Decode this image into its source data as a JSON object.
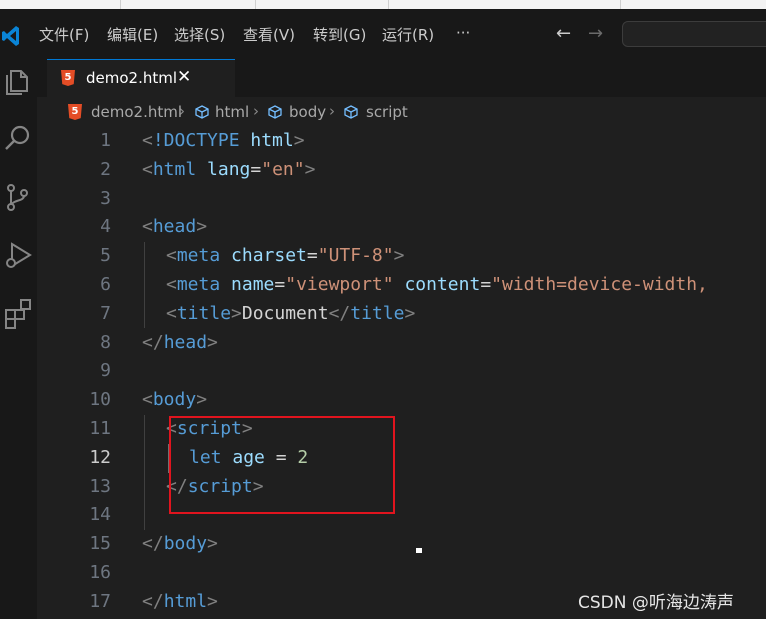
{
  "menu": [
    "文件(F)",
    "编辑(E)",
    "选择(S)",
    "查看(V)",
    "转到(G)",
    "运行(R)",
    "···"
  ],
  "tab": {
    "label": "demo2.html",
    "close": "✕"
  },
  "breadcrumb": [
    "demo2.html",
    "html",
    "body",
    "script"
  ],
  "editor": {
    "line_numbers": [
      "1",
      "2",
      "3",
      "4",
      "5",
      "6",
      "7",
      "8",
      "9",
      "10",
      "11",
      "12",
      "13",
      "14",
      "15",
      "16",
      "17"
    ],
    "active_line": 12
  },
  "code": {
    "l1": {
      "a": "<",
      "b": "!DOCTYPE",
      "c": " html",
      "d": ">"
    },
    "l2": {
      "a": "<",
      "b": "html",
      "c": " lang",
      "d": "=",
      "e": "\"en\"",
      "f": ">"
    },
    "l4": {
      "a": "<",
      "b": "head",
      "c": ">"
    },
    "l5": {
      "a": "<",
      "b": "meta",
      "c": " charset",
      "d": "=",
      "e": "\"UTF-8\"",
      "f": ">"
    },
    "l6": {
      "a": "<",
      "b": "meta",
      "c": " name",
      "d": "=",
      "e": "\"viewport\"",
      "f": " content",
      "g": "=",
      "h": "\"width=device-width,"
    },
    "l7": {
      "a": "<",
      "b": "title",
      "c": ">",
      "d": "Document",
      "e": "</",
      "f": "title",
      "g": ">"
    },
    "l8": {
      "a": "</",
      "b": "head",
      "c": ">"
    },
    "l10": {
      "a": "<",
      "b": "body",
      "c": ">"
    },
    "l11": {
      "a": "<",
      "b": "script",
      "c": ">"
    },
    "l12": {
      "a": "let",
      "b": " age",
      "c": " = ",
      "d": "2"
    },
    "l13": {
      "a": "</",
      "b": "script",
      "c": ">"
    },
    "l15": {
      "a": "</",
      "b": "body",
      "c": ">"
    },
    "l17": {
      "a": "</",
      "b": "html",
      "c": ">"
    }
  },
  "watermark": "CSDN @听海边涛声",
  "colors": {
    "accent": "#0078d4",
    "annotation_box": "#e0141e",
    "html5": "#e44d26"
  }
}
